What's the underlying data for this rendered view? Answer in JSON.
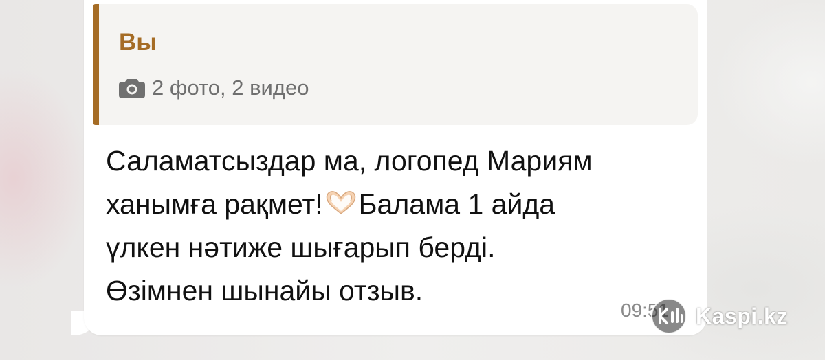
{
  "reply": {
    "author": "Вы",
    "media_icon": "camera-icon",
    "media_summary": "2 фото, 2 видео",
    "accent_color": "#a56c25"
  },
  "message": {
    "lines": [
      "Саламатсыздар ма, логопед Мариям",
      "ханымға рақмет!",
      "Балама 1 айда",
      "үлкен нәтиже шығарып берді.",
      "Өзімнен шынайы отзыв."
    ],
    "inline_emoji": "heart-hands-icon",
    "time": "09:51"
  },
  "watermark": {
    "text": "Kaspi.kz",
    "logo_icon": "kaspi-logo-icon"
  },
  "colors": {
    "bubble": "#ffffff",
    "text": "#111111",
    "secondary_text": "#6f6f6f",
    "background": "#ecebe9"
  }
}
